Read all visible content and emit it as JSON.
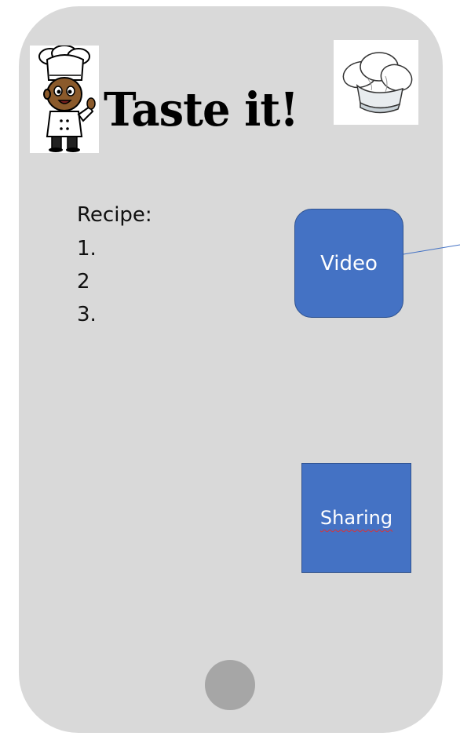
{
  "header": {
    "title": "Taste it!",
    "chef_icon": "chef-character-icon",
    "hat_icon": "chef-hat-icon"
  },
  "recipe": {
    "heading": "Recipe:",
    "steps": [
      "1.",
      "2",
      "3."
    ]
  },
  "buttons": {
    "video_label": "Video",
    "sharing_label": "Sharing"
  },
  "colors": {
    "phone_body": "#d9d9d9",
    "button_fill": "#4472c4",
    "button_border": "#2f528f",
    "home_button": "#a6a6a6",
    "connector_line": "#4472c4"
  }
}
